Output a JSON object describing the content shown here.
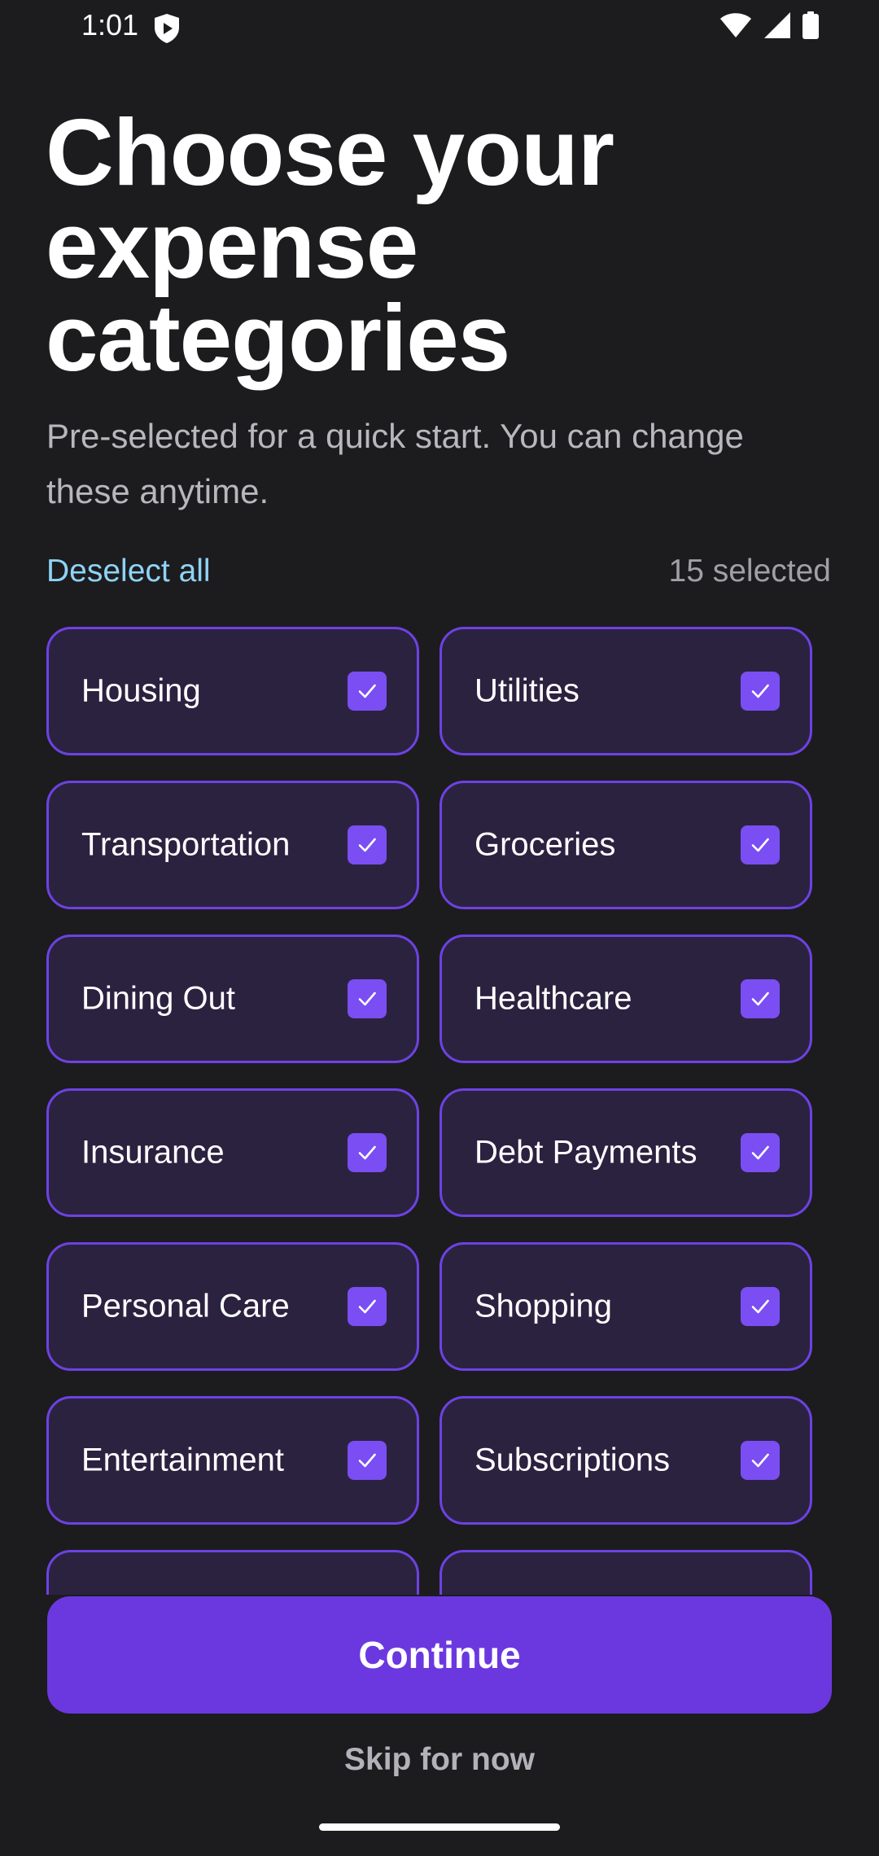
{
  "status_bar": {
    "time": "1:01",
    "shield_icon": "shield-play-icon",
    "wifi_icon": "wifi-icon",
    "signal_icon": "signal-icon",
    "battery_icon": "battery-icon"
  },
  "header": {
    "title": "Choose your expense categories",
    "subtitle": "Pre-selected for a quick start. You can change these anytime."
  },
  "selection": {
    "deselect_label": "Deselect all",
    "count_label": "15 selected"
  },
  "categories": [
    {
      "label": "Housing",
      "checked": true
    },
    {
      "label": "Utilities",
      "checked": true
    },
    {
      "label": "Transportation",
      "checked": true
    },
    {
      "label": "Groceries",
      "checked": true
    },
    {
      "label": "Dining Out",
      "checked": true
    },
    {
      "label": "Healthcare",
      "checked": true
    },
    {
      "label": "Insurance",
      "checked": true
    },
    {
      "label": "Debt Payments",
      "checked": true
    },
    {
      "label": "Personal Care",
      "checked": true
    },
    {
      "label": "Shopping",
      "checked": true
    },
    {
      "label": "Entertainment",
      "checked": true
    },
    {
      "label": "Subscriptions",
      "checked": true
    },
    {
      "label": "",
      "checked": true
    },
    {
      "label": "",
      "checked": true
    }
  ],
  "actions": {
    "continue_label": "Continue",
    "skip_label": "Skip for now"
  },
  "colors": {
    "background": "#1c1c1e",
    "accent": "#6b38e0",
    "card_background": "#2b2240",
    "card_border": "#6d42e3",
    "checkbox": "#7a4ef2",
    "link": "#8fd3f5"
  }
}
